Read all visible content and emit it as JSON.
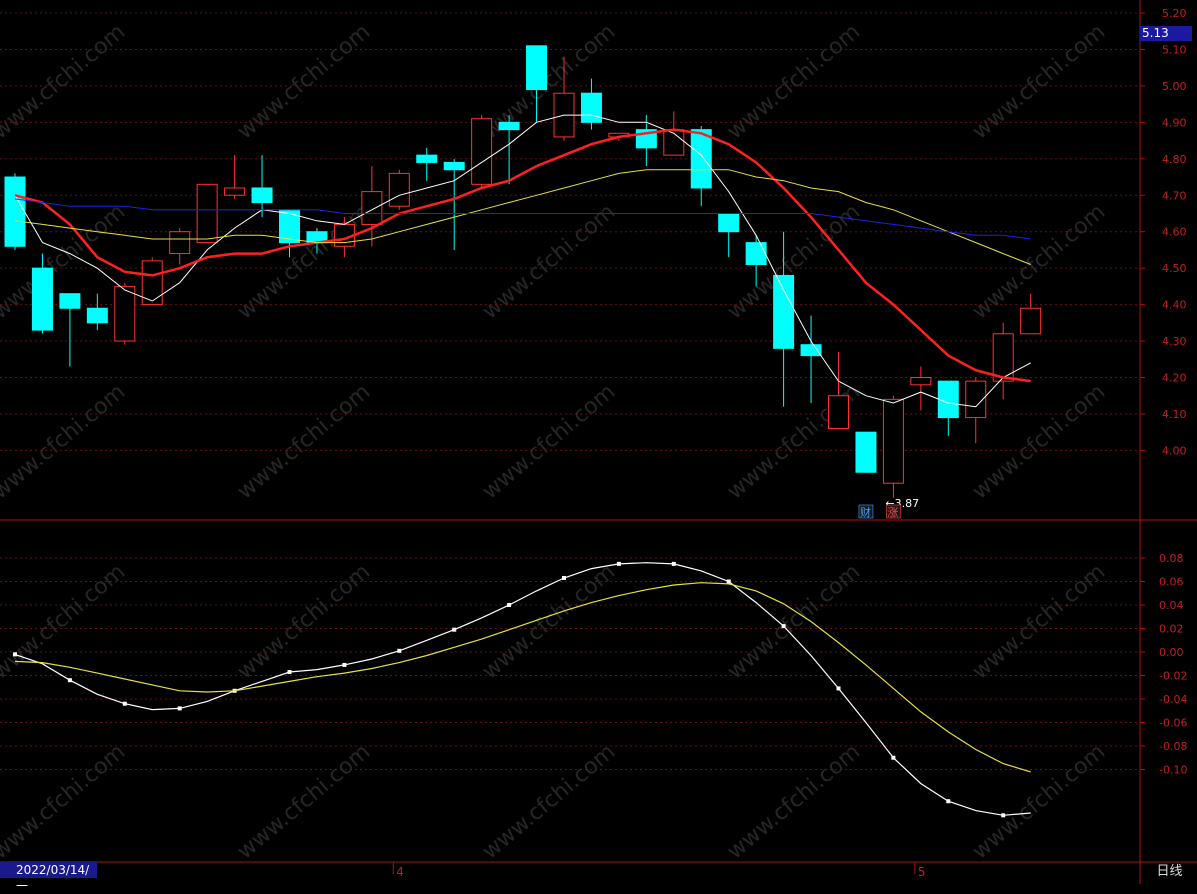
{
  "chart_data": [
    {
      "type": "candlestick",
      "period_label": "日线",
      "current_price": "5.13",
      "ylim": [
        3.78,
        5.24
      ],
      "y_ticks": [
        "5.20",
        "5.10",
        "5.00",
        "4.90",
        "4.80",
        "4.70",
        "4.60",
        "4.50",
        "4.40",
        "4.30",
        "4.20",
        "4.10",
        "4.00"
      ],
      "x_marks": [
        {
          "index": 0,
          "label": "2022/03/14/一"
        },
        {
          "index": 14,
          "label": "4"
        },
        {
          "index": 33,
          "label": "5"
        }
      ],
      "min_annotation": {
        "index": 32,
        "text": "←3.87"
      },
      "event_badges": [
        {
          "index": 31,
          "text": "财",
          "color": "#3fa0ff"
        },
        {
          "index": 32,
          "text": "涨",
          "color": "#ff4444"
        }
      ],
      "candles": [
        {
          "o": 4.75,
          "h": 4.76,
          "l": 4.55,
          "c": 4.56
        },
        {
          "o": 4.5,
          "h": 4.54,
          "l": 4.32,
          "c": 4.33
        },
        {
          "o": 4.43,
          "h": 4.43,
          "l": 4.23,
          "c": 4.39
        },
        {
          "o": 4.39,
          "h": 4.43,
          "l": 4.33,
          "c": 4.35
        },
        {
          "o": 4.3,
          "h": 4.46,
          "l": 4.29,
          "c": 4.45
        },
        {
          "o": 4.4,
          "h": 4.53,
          "l": 4.4,
          "c": 4.52
        },
        {
          "o": 4.54,
          "h": 4.61,
          "l": 4.51,
          "c": 4.6
        },
        {
          "o": 4.57,
          "h": 4.73,
          "l": 4.57,
          "c": 4.73
        },
        {
          "o": 4.7,
          "h": 4.81,
          "l": 4.69,
          "c": 4.72
        },
        {
          "o": 4.72,
          "h": 4.81,
          "l": 4.64,
          "c": 4.68
        },
        {
          "o": 4.66,
          "h": 4.66,
          "l": 4.53,
          "c": 4.57
        },
        {
          "o": 4.6,
          "h": 4.61,
          "l": 4.54,
          "c": 4.57
        },
        {
          "o": 4.56,
          "h": 4.64,
          "l": 4.53,
          "c": 4.62
        },
        {
          "o": 4.62,
          "h": 4.78,
          "l": 4.56,
          "c": 4.71
        },
        {
          "o": 4.67,
          "h": 4.77,
          "l": 4.66,
          "c": 4.76
        },
        {
          "o": 4.81,
          "h": 4.83,
          "l": 4.74,
          "c": 4.79
        },
        {
          "o": 4.79,
          "h": 4.8,
          "l": 4.55,
          "c": 4.77
        },
        {
          "o": 4.73,
          "h": 4.92,
          "l": 4.72,
          "c": 4.91
        },
        {
          "o": 4.9,
          "h": 4.92,
          "l": 4.73,
          "c": 4.88
        },
        {
          "o": 5.11,
          "h": 5.11,
          "l": 4.9,
          "c": 4.99
        },
        {
          "o": 4.86,
          "h": 5.08,
          "l": 4.85,
          "c": 4.98
        },
        {
          "o": 4.98,
          "h": 5.02,
          "l": 4.88,
          "c": 4.9
        },
        {
          "o": 4.86,
          "h": 4.86,
          "l": 4.85,
          "c": 4.87
        },
        {
          "o": 4.88,
          "h": 4.92,
          "l": 4.78,
          "c": 4.83
        },
        {
          "o": 4.81,
          "h": 4.93,
          "l": 4.81,
          "c": 4.88
        },
        {
          "o": 4.88,
          "h": 4.89,
          "l": 4.67,
          "c": 4.72
        },
        {
          "o": 4.65,
          "h": 4.65,
          "l": 4.53,
          "c": 4.6
        },
        {
          "o": 4.57,
          "h": 4.59,
          "l": 4.45,
          "c": 4.51
        },
        {
          "o": 4.48,
          "h": 4.6,
          "l": 4.12,
          "c": 4.28
        },
        {
          "o": 4.29,
          "h": 4.37,
          "l": 4.13,
          "c": 4.26
        },
        {
          "o": 4.06,
          "h": 4.27,
          "l": 4.06,
          "c": 4.15
        },
        {
          "o": 4.05,
          "h": 4.05,
          "l": 3.94,
          "c": 3.94
        },
        {
          "o": 3.91,
          "h": 4.15,
          "l": 3.87,
          "c": 4.14
        },
        {
          "o": 4.18,
          "h": 4.23,
          "l": 4.11,
          "c": 4.2
        },
        {
          "o": 4.19,
          "h": 4.19,
          "l": 4.04,
          "c": 4.09
        },
        {
          "o": 4.09,
          "h": 4.2,
          "l": 4.02,
          "c": 4.19
        },
        {
          "o": 4.19,
          "h": 4.35,
          "l": 4.14,
          "c": 4.32
        },
        {
          "o": 4.32,
          "h": 4.43,
          "l": 4.32,
          "c": 4.39
        }
      ],
      "ma_lines": [
        {
          "color": "#ffffff",
          "width": 1,
          "values": [
            4.7,
            4.57,
            4.54,
            4.5,
            4.44,
            4.41,
            4.46,
            4.55,
            4.61,
            4.66,
            4.65,
            4.63,
            4.62,
            4.66,
            4.7,
            4.72,
            4.74,
            4.79,
            4.84,
            4.9,
            4.92,
            4.92,
            4.9,
            4.9,
            4.87,
            4.81,
            4.71,
            4.59,
            4.44,
            4.3,
            4.19,
            4.15,
            4.13,
            4.16,
            4.13,
            4.12,
            4.2,
            4.24
          ]
        },
        {
          "color": "#ff2020",
          "width": 2.5,
          "values": [
            4.7,
            4.68,
            4.62,
            4.53,
            4.49,
            4.48,
            4.5,
            4.53,
            4.54,
            4.54,
            4.56,
            4.57,
            4.58,
            4.61,
            4.65,
            4.67,
            4.69,
            4.72,
            4.74,
            4.78,
            4.81,
            4.84,
            4.86,
            4.87,
            4.88,
            4.87,
            4.84,
            4.79,
            4.72,
            4.64,
            4.55,
            4.46,
            4.4,
            4.33,
            4.26,
            4.22,
            4.2,
            4.19
          ]
        },
        {
          "color": "#e6e040",
          "width": 1,
          "values": [
            4.63,
            4.62,
            4.61,
            4.6,
            4.59,
            4.58,
            4.58,
            4.58,
            4.59,
            4.59,
            4.58,
            4.57,
            4.57,
            4.58,
            4.6,
            4.62,
            4.64,
            4.66,
            4.68,
            4.7,
            4.72,
            4.74,
            4.76,
            4.77,
            4.77,
            4.77,
            4.77,
            4.75,
            4.74,
            4.72,
            4.71,
            4.68,
            4.66,
            4.63,
            4.6,
            4.57,
            4.54,
            4.51
          ]
        },
        {
          "color": "#2020e6",
          "width": 1,
          "values": [
            4.69,
            4.68,
            4.67,
            4.67,
            4.67,
            4.66,
            4.66,
            4.66,
            4.66,
            4.66,
            4.66,
            4.66,
            4.65,
            4.65,
            4.65,
            4.65,
            4.65,
            4.65,
            4.65,
            4.65,
            4.65,
            4.65,
            4.65,
            4.65,
            4.65,
            4.65,
            4.65,
            4.65,
            4.65,
            4.65,
            4.64,
            4.63,
            4.62,
            4.61,
            4.6,
            4.59,
            4.59,
            4.58
          ]
        }
      ]
    },
    {
      "type": "line",
      "ylim": [
        -0.128,
        0.087
      ],
      "y_ticks": [
        "0.08",
        "0.06",
        "0.04",
        "0.02",
        "0.00",
        "-0.02",
        "-0.04",
        "-0.06",
        "-0.08",
        "-0.10"
      ],
      "series": [
        {
          "color": "#ffffff",
          "marker_every": 2,
          "values": [
            -0.002,
            -0.01,
            -0.024,
            -0.036,
            -0.044,
            -0.049,
            -0.048,
            -0.042,
            -0.033,
            -0.025,
            -0.017,
            -0.015,
            -0.011,
            -0.006,
            0.001,
            0.01,
            0.019,
            0.029,
            0.04,
            0.052,
            0.063,
            0.071,
            0.075,
            0.076,
            0.075,
            0.069,
            0.06,
            0.042,
            0.022,
            -0.003,
            -0.031,
            -0.06,
            -0.09,
            -0.112,
            -0.127,
            -0.135,
            -0.139,
            -0.137
          ]
        },
        {
          "color": "#e6e040",
          "values": [
            -0.008,
            -0.009,
            -0.013,
            -0.018,
            -0.023,
            -0.028,
            -0.033,
            -0.034,
            -0.033,
            -0.029,
            -0.025,
            -0.021,
            -0.018,
            -0.014,
            -0.009,
            -0.003,
            0.004,
            0.011,
            0.019,
            0.027,
            0.035,
            0.042,
            0.048,
            0.053,
            0.057,
            0.059,
            0.058,
            0.052,
            0.041,
            0.026,
            0.008,
            -0.011,
            -0.031,
            -0.051,
            -0.068,
            -0.083,
            -0.095,
            -0.102
          ]
        }
      ]
    }
  ],
  "watermark_text": "www.cfchi.com"
}
